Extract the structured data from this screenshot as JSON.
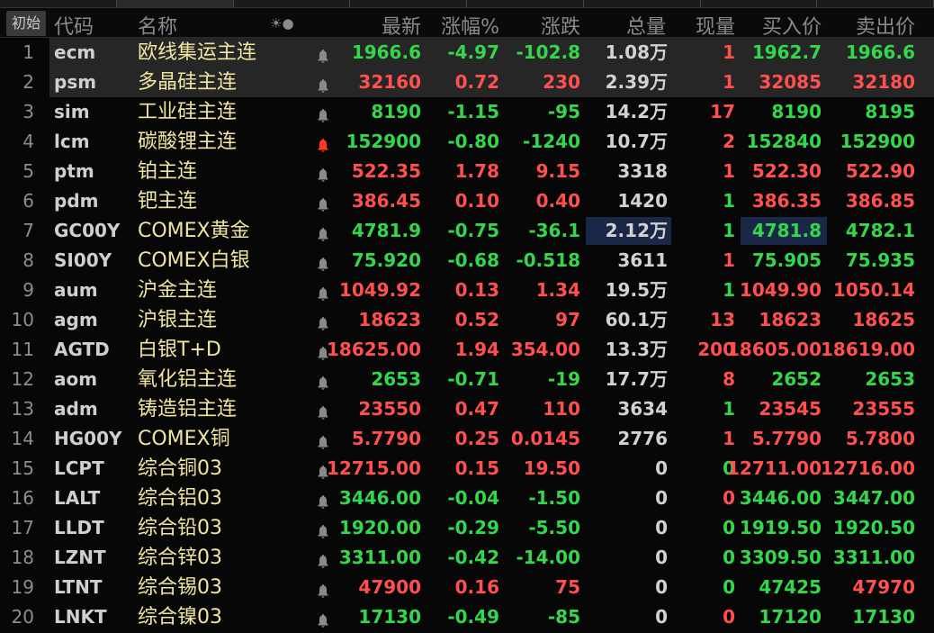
{
  "toolbar": {
    "init_label": "初始"
  },
  "headers": {
    "code": "代码",
    "name": "名称",
    "icons": "☀●",
    "last": "最新",
    "pct": "涨幅%",
    "chg": "涨跌",
    "vol": "总量",
    "cur": "现量",
    "bid": "买入价",
    "ask": "卖出价"
  },
  "colors": {
    "up": "#ff4f4f",
    "down": "#32d74b",
    "neutral": "#d2d2d2",
    "name": "#f0e6a0",
    "alert_active": "#ff3b1f"
  },
  "rows": [
    {
      "n": "1",
      "code": "ecm",
      "name": "欧线集运主连",
      "alert": false,
      "last": "1966.6",
      "pct": "-4.97",
      "chg": "-102.8",
      "vol": "1.08",
      "unit": "万",
      "cur": "1",
      "c": "g",
      "cc": "r",
      "bc": "g",
      "ac": "g",
      "bid": "1962.7",
      "ask": "1966.6",
      "sel": true
    },
    {
      "n": "2",
      "code": "psm",
      "name": "多晶硅主连",
      "alert": false,
      "last": "32160",
      "pct": "0.72",
      "chg": "230",
      "vol": "2.39",
      "unit": "万",
      "cur": "1",
      "c": "r",
      "cc": "r",
      "bc": "r",
      "ac": "r",
      "bid": "32085",
      "ask": "32180",
      "sel": true
    },
    {
      "n": "3",
      "code": "sim",
      "name": "工业硅主连",
      "alert": false,
      "last": "8190",
      "pct": "-1.15",
      "chg": "-95",
      "vol": "14.2",
      "unit": "万",
      "cur": "17",
      "c": "g",
      "cc": "r",
      "bc": "g",
      "ac": "g",
      "bid": "8190",
      "ask": "8195"
    },
    {
      "n": "4",
      "code": "lcm",
      "name": "碳酸锂主连",
      "alert": true,
      "last": "152900",
      "pct": "-0.80",
      "chg": "-1240",
      "vol": "10.7",
      "unit": "万",
      "cur": "2",
      "c": "g",
      "cc": "r",
      "bc": "g",
      "ac": "g",
      "bid": "152840",
      "ask": "152900"
    },
    {
      "n": "5",
      "code": "ptm",
      "name": "铂主连",
      "alert": false,
      "last": "522.35",
      "pct": "1.78",
      "chg": "9.15",
      "vol": "3318",
      "unit": "",
      "cur": "1",
      "c": "r",
      "cc": "r",
      "bc": "r",
      "ac": "r",
      "bid": "522.30",
      "ask": "522.90"
    },
    {
      "n": "6",
      "code": "pdm",
      "name": "钯主连",
      "alert": false,
      "last": "386.45",
      "pct": "0.10",
      "chg": "0.40",
      "vol": "1420",
      "unit": "",
      "cur": "1",
      "c": "r",
      "cc": "g",
      "bc": "r",
      "ac": "r",
      "bid": "386.35",
      "ask": "386.85"
    },
    {
      "n": "7",
      "code": "GC00Y",
      "name": "COMEX黄金",
      "alert": false,
      "last": "4781.9",
      "pct": "-0.75",
      "chg": "-36.1",
      "vol": "2.12",
      "unit": "万",
      "cur": "1",
      "c": "g",
      "cc": "g",
      "bc": "g",
      "ac": "g",
      "bid": "4781.8",
      "ask": "4782.1",
      "hl": true
    },
    {
      "n": "8",
      "code": "SI00Y",
      "name": "COMEX白银",
      "alert": false,
      "last": "75.920",
      "pct": "-0.68",
      "chg": "-0.518",
      "vol": "3611",
      "unit": "",
      "cur": "1",
      "c": "g",
      "cc": "r",
      "bc": "g",
      "ac": "g",
      "bid": "75.905",
      "ask": "75.935"
    },
    {
      "n": "9",
      "code": "aum",
      "name": "沪金主连",
      "alert": false,
      "last": "1049.92",
      "pct": "0.13",
      "chg": "1.34",
      "vol": "19.5",
      "unit": "万",
      "cur": "1",
      "c": "r",
      "cc": "g",
      "bc": "r",
      "ac": "r",
      "bid": "1049.90",
      "ask": "1050.14"
    },
    {
      "n": "10",
      "code": "agm",
      "name": "沪银主连",
      "alert": false,
      "last": "18623",
      "pct": "0.52",
      "chg": "97",
      "vol": "60.1",
      "unit": "万",
      "cur": "13",
      "c": "r",
      "cc": "r",
      "bc": "r",
      "ac": "r",
      "bid": "18623",
      "ask": "18625"
    },
    {
      "n": "11",
      "code": "AGTD",
      "name": "白银T+D",
      "alert": false,
      "last": "18625.00",
      "pct": "1.94",
      "chg": "354.00",
      "vol": "13.3",
      "unit": "万",
      "cur": "200",
      "c": "r",
      "cc": "r",
      "bc": "r",
      "ac": "r",
      "bid": "18605.00",
      "ask": "18619.00"
    },
    {
      "n": "12",
      "code": "aom",
      "name": "氧化铝主连",
      "alert": false,
      "last": "2653",
      "pct": "-0.71",
      "chg": "-19",
      "vol": "17.7",
      "unit": "万",
      "cur": "8",
      "c": "g",
      "cc": "r",
      "bc": "g",
      "ac": "g",
      "bid": "2652",
      "ask": "2653"
    },
    {
      "n": "13",
      "code": "adm",
      "name": "铸造铝主连",
      "alert": false,
      "last": "23550",
      "pct": "0.47",
      "chg": "110",
      "vol": "3634",
      "unit": "",
      "cur": "1",
      "c": "r",
      "cc": "g",
      "bc": "r",
      "ac": "r",
      "bid": "23545",
      "ask": "23555"
    },
    {
      "n": "14",
      "code": "HG00Y",
      "name": "COMEX铜",
      "alert": false,
      "last": "5.7790",
      "pct": "0.25",
      "chg": "0.0145",
      "vol": "2776",
      "unit": "",
      "cur": "1",
      "c": "r",
      "cc": "r",
      "bc": "r",
      "ac": "r",
      "bid": "5.7790",
      "ask": "5.7800"
    },
    {
      "n": "15",
      "code": "LCPT",
      "name": "综合铜03",
      "alert": false,
      "last": "12715.00",
      "pct": "0.15",
      "chg": "19.50",
      "vol": "0",
      "unit": "",
      "cur": "0",
      "c": "r",
      "cc": "g",
      "bc": "r",
      "ac": "r",
      "bid": "12711.00",
      "ask": "12716.00"
    },
    {
      "n": "16",
      "code": "LALT",
      "name": "综合铝03",
      "alert": false,
      "last": "3446.00",
      "pct": "-0.04",
      "chg": "-1.50",
      "vol": "0",
      "unit": "",
      "cur": "0",
      "c": "g",
      "cc": "r",
      "bc": "g",
      "ac": "g",
      "bid": "3446.00",
      "ask": "3447.00"
    },
    {
      "n": "17",
      "code": "LLDT",
      "name": "综合铅03",
      "alert": false,
      "last": "1920.00",
      "pct": "-0.29",
      "chg": "-5.50",
      "vol": "0",
      "unit": "",
      "cur": "0",
      "c": "g",
      "cc": "g",
      "bc": "g",
      "ac": "g",
      "bid": "1919.50",
      "ask": "1920.50"
    },
    {
      "n": "18",
      "code": "LZNT",
      "name": "综合锌03",
      "alert": false,
      "last": "3311.00",
      "pct": "-0.42",
      "chg": "-14.00",
      "vol": "0",
      "unit": "",
      "cur": "0",
      "c": "g",
      "cc": "g",
      "bc": "g",
      "ac": "g",
      "bid": "3309.50",
      "ask": "3311.00"
    },
    {
      "n": "19",
      "code": "LTNT",
      "name": "综合锡03",
      "alert": false,
      "last": "47900",
      "pct": "0.16",
      "chg": "75",
      "vol": "0",
      "unit": "",
      "cur": "0",
      "c": "r",
      "cc": "g",
      "bc": "g",
      "ac": "r",
      "bid": "47425",
      "ask": "47970"
    },
    {
      "n": "20",
      "code": "LNKT",
      "name": "综合镍03",
      "alert": false,
      "last": "17130",
      "pct": "-0.49",
      "chg": "-85",
      "vol": "0",
      "unit": "",
      "cur": "0",
      "c": "g",
      "cc": "r",
      "bc": "g",
      "ac": "g",
      "bid": "17120",
      "ask": "17130"
    }
  ]
}
